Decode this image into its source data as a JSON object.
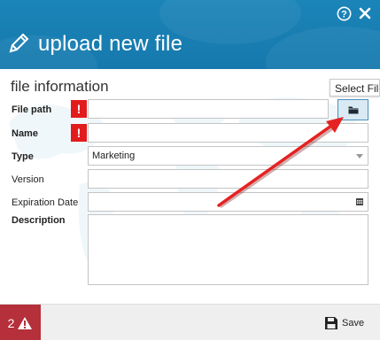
{
  "header": {
    "title": "upload new file",
    "help_icon": "question-circle-icon",
    "close_icon": "close-icon",
    "title_icon": "pencil-icon",
    "bg_color": "#1b84b8"
  },
  "form": {
    "section_title": "file information",
    "tooltip": "Select File",
    "fields": {
      "file_path": {
        "label": "File path",
        "value": "",
        "required_mark": "!"
      },
      "name": {
        "label": "Name",
        "value": "",
        "required_mark": "!"
      },
      "type": {
        "label": "Type",
        "value": "Marketing"
      },
      "version": {
        "label": "Version",
        "value": ""
      },
      "expiration_date": {
        "label": "Expiration Date",
        "value": ""
      },
      "description": {
        "label": "Description",
        "value": ""
      }
    },
    "browse_icon": "folder-icon",
    "required_color": "#e21c1c"
  },
  "footer": {
    "error_count": "2",
    "error_icon": "warning-triangle-icon",
    "save_label": "Save",
    "save_icon": "floppy-disk-icon",
    "error_color": "#b5303a"
  },
  "annotation": {
    "arrow_color": "#e52222"
  }
}
